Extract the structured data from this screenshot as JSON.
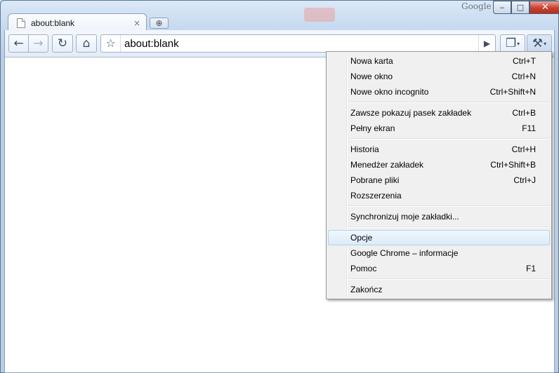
{
  "titlebar": {
    "brand": "Google",
    "minimize": "‒",
    "maximize": "□",
    "close": "✕"
  },
  "tab": {
    "title": "about:blank",
    "close_glyph": "×"
  },
  "toolbar": {
    "back_glyph": "←",
    "forward_glyph": "→",
    "reload_glyph": "↻",
    "home_glyph": "⌂",
    "star_glyph": "☆",
    "go_glyph": "▶",
    "page_glyph": "❐",
    "wrench_glyph": "⚒",
    "caret": "▾",
    "new_tab_glyph": "⊕"
  },
  "omnibox": {
    "value": "about:blank"
  },
  "menu": {
    "items": [
      {
        "label": "Nowa karta",
        "shortcut": "Ctrl+T"
      },
      {
        "label": "Nowe okno",
        "shortcut": "Ctrl+N"
      },
      {
        "label": "Nowe okno incognito",
        "shortcut": "Ctrl+Shift+N"
      },
      {
        "label": "Zawsze pokazuj pasek zakładek",
        "shortcut": "Ctrl+B"
      },
      {
        "label": "Pełny ekran",
        "shortcut": "F11"
      },
      {
        "label": "Historia",
        "shortcut": "Ctrl+H"
      },
      {
        "label": "Menedżer zakładek",
        "shortcut": "Ctrl+Shift+B"
      },
      {
        "label": "Pobrane pliki",
        "shortcut": "Ctrl+J"
      },
      {
        "label": "Rozszerzenia",
        "shortcut": ""
      },
      {
        "label": "Synchronizuj moje zakładki...",
        "shortcut": ""
      },
      {
        "label": "Opcje",
        "shortcut": ""
      },
      {
        "label": "Google Chrome – informacje",
        "shortcut": ""
      },
      {
        "label": "Pomoc",
        "shortcut": "F1"
      },
      {
        "label": "Zakończ",
        "shortcut": ""
      }
    ],
    "highlighted_item": "Opcje"
  },
  "colors": {
    "menu_highlight": "#dceaf9",
    "close_button": "#c8412f",
    "frame": "#c6d9ef"
  },
  "icons": {
    "back": "arrow-left-icon",
    "forward": "arrow-right-icon",
    "reload": "reload-icon",
    "home": "home-icon",
    "star": "star-icon",
    "go": "play-icon",
    "page": "page-icon",
    "wrench": "wrench-icon"
  }
}
